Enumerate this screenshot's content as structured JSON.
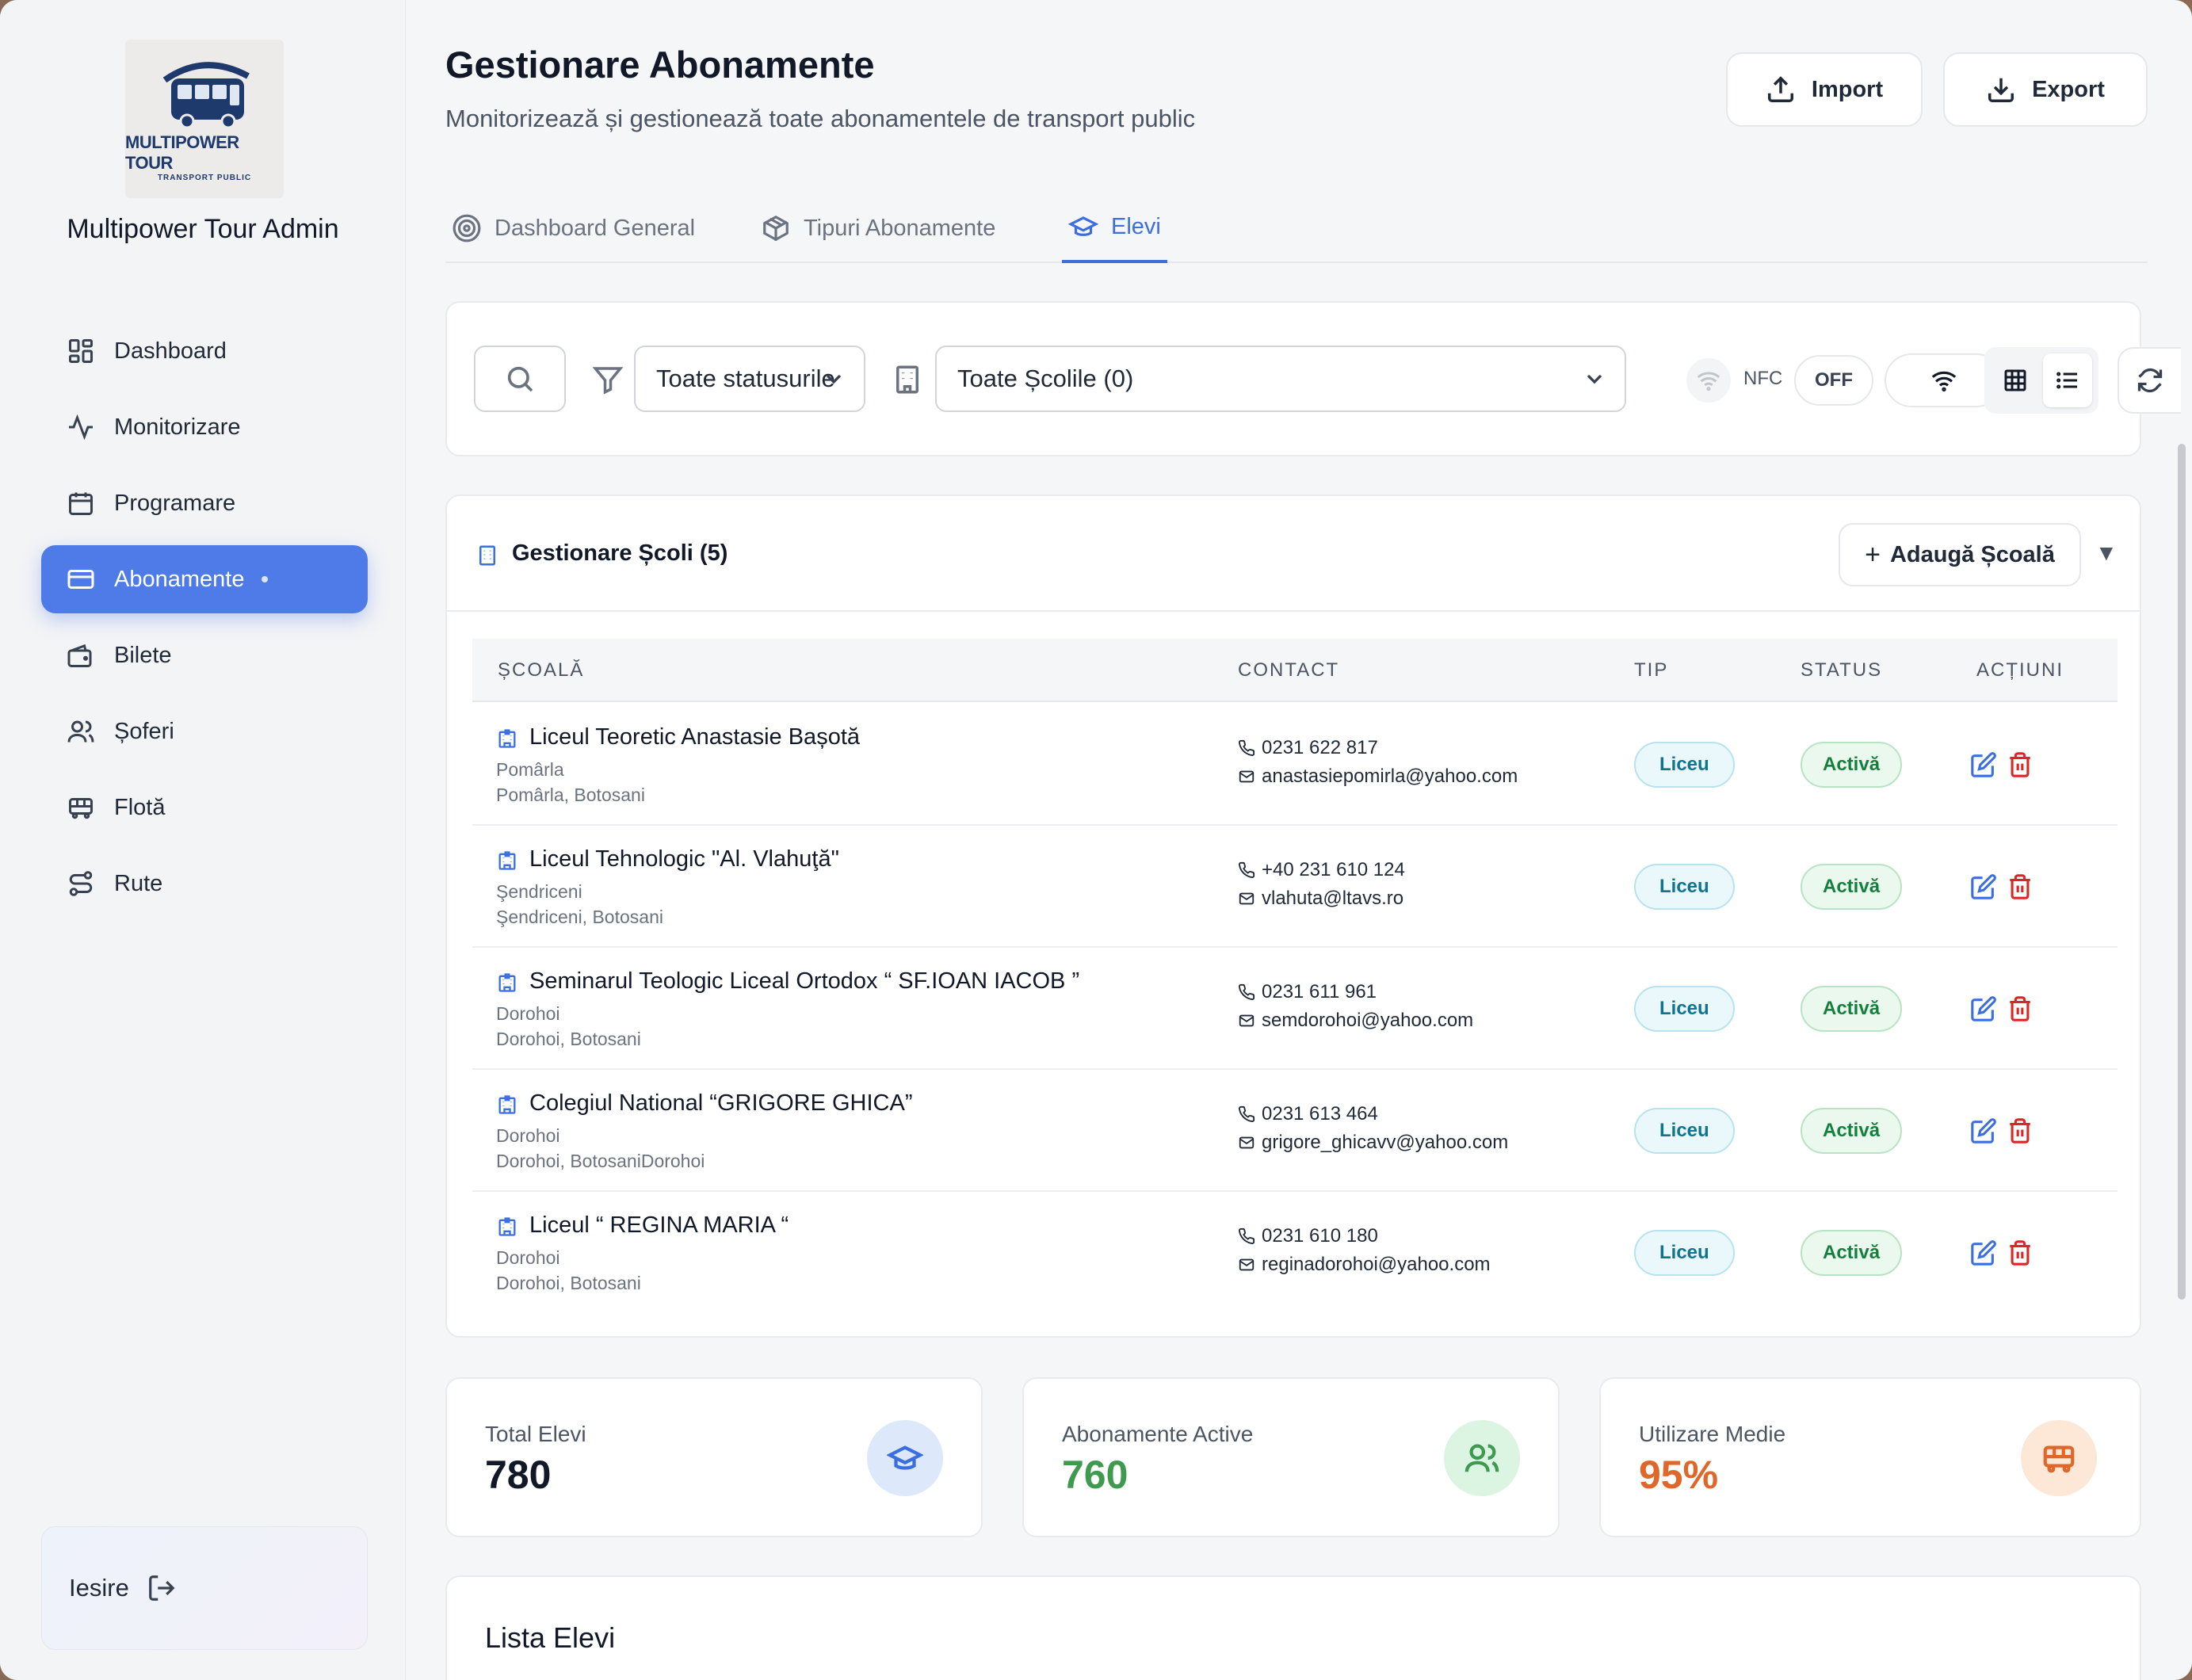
{
  "sidebar": {
    "logo": {
      "title": "MULTIPOWER TOUR",
      "subtitle": "TRANSPORT PUBLIC"
    },
    "app_name": "Multipower Tour Admin",
    "items": [
      {
        "label": "Dashboard",
        "icon": "dashboard-icon"
      },
      {
        "label": "Monitorizare",
        "icon": "activity-icon"
      },
      {
        "label": "Programare",
        "icon": "calendar-icon"
      },
      {
        "label": "Abonamente",
        "icon": "credit-card-icon",
        "active": true
      },
      {
        "label": "Bilete",
        "icon": "wallet-icon"
      },
      {
        "label": "Șoferi",
        "icon": "users-icon"
      },
      {
        "label": "Flotă",
        "icon": "bus-icon"
      },
      {
        "label": "Rute",
        "icon": "route-icon"
      }
    ],
    "logout_label": "Iesire"
  },
  "header": {
    "title": "Gestionare Abonamente",
    "subtitle": "Monitorizează și gestionează toate abonamentele de transport public",
    "import_label": "Import",
    "export_label": "Export"
  },
  "tabs": [
    {
      "label": "Dashboard General",
      "icon": "target-icon"
    },
    {
      "label": "Tipuri Abonamente",
      "icon": "package-icon"
    },
    {
      "label": "Elevi",
      "icon": "graduation-cap-icon",
      "active": true
    }
  ],
  "filters": {
    "status_value": "Toate statusurile",
    "school_value": "Toate Școlile (0)",
    "nfc_label": "NFC",
    "nfc_state": "OFF"
  },
  "schools": {
    "title": "Gestionare Școli (5)",
    "add_label": "Adaugă Școală",
    "collapse_glyph": "▼",
    "columns": [
      "ȘCOALĂ",
      "CONTACT",
      "TIP",
      "STATUS",
      "ACȚIUNI"
    ],
    "rows": [
      {
        "name": "Liceul Teoretic Anastasie Bașotă",
        "locality": "Pomârla",
        "address": "Pomârla, Botosani",
        "phone": "0231 622 817",
        "email": "anastasiepomirla@yahoo.com",
        "type": "Liceu",
        "status": "Activă"
      },
      {
        "name": "Liceul Tehnologic \"Al. Vlahuţă\"",
        "locality": "Şendriceni",
        "address": "Şendriceni, Botosani",
        "phone": "+40 231 610 124",
        "email": "vlahuta@ltavs.ro",
        "type": "Liceu",
        "status": "Activă"
      },
      {
        "name": "Seminarul Teologic Liceal Ortodox “ SF.IOAN IACOB ”",
        "locality": "Dorohoi",
        "address": "Dorohoi, Botosani",
        "phone": "0231 611 961",
        "email": "semdorohoi@yahoo.com",
        "type": "Liceu",
        "status": "Activă"
      },
      {
        "name": "Colegiul National “GRIGORE GHICA”",
        "locality": "Dorohoi",
        "address": "Dorohoi, BotosaniDorohoi",
        "phone": "0231 613 464",
        "email": "grigore_ghicavv@yahoo.com",
        "type": "Liceu",
        "status": "Activă"
      },
      {
        "name": "Liceul “ REGINA MARIA “",
        "locality": "Dorohoi",
        "address": "Dorohoi, Botosani",
        "phone": "0231 610 180",
        "email": "reginadorohoi@yahoo.com",
        "type": "Liceu",
        "status": "Activă"
      }
    ]
  },
  "stats": [
    {
      "label": "Total Elevi",
      "value": "780",
      "color": "#111827",
      "icon": "graduation-cap-icon"
    },
    {
      "label": "Abonamente Active",
      "value": "760",
      "color": "#3f9a4f",
      "icon": "users-icon"
    },
    {
      "label": "Utilizare Medie",
      "value": "95%",
      "color": "#e0672a",
      "icon": "bus-icon"
    }
  ],
  "list": {
    "title": "Lista Elevi"
  },
  "colors": {
    "accent": "#4f7be8",
    "link": "#3b6fe0",
    "danger": "#dc2626",
    "success": "#15803d"
  }
}
